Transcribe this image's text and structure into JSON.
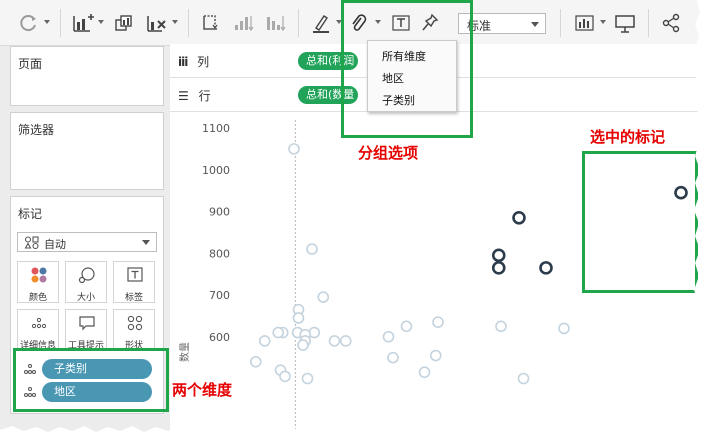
{
  "toolbar": {
    "icons": [
      "refresh-icon",
      "new-chart-icon",
      "duplicate-icon",
      "clear-icon",
      "swap-icon",
      "sort-asc-icon",
      "sort-desc-icon",
      "highlight-icon",
      "paperclip-icon",
      "text-label-icon",
      "pin-icon",
      "show-me-icon",
      "presentation-icon",
      "share-icon"
    ],
    "fit_select_value": "标准"
  },
  "panes": {
    "pages_title": "页面",
    "filters_title": "筛选器",
    "marks_title": "标记",
    "marks_type": "自动",
    "mark_buttons": [
      {
        "label": "颜色",
        "icon": "color-icon"
      },
      {
        "label": "大小",
        "icon": "size-icon"
      },
      {
        "label": "标签",
        "icon": "label-icon"
      },
      {
        "label": "详细信息",
        "icon": "detail-icon"
      },
      {
        "label": "工具提示",
        "icon": "tooltip-icon"
      },
      {
        "label": "形状",
        "icon": "shape-icon"
      }
    ],
    "detail_pills": [
      "子类别",
      "地区"
    ]
  },
  "shelves": {
    "columns_label": "列",
    "columns_pill": "总和(利润",
    "rows_label": "行",
    "rows_pill": "总和(数量"
  },
  "menu": {
    "items": [
      "所有维度",
      "地区",
      "子类别"
    ]
  },
  "annotations": {
    "group_options": "分组选项",
    "selected_marks": "选中的标记",
    "two_dimensions": "两个维度"
  },
  "chart_data": {
    "type": "scatter",
    "ylabel": "数量",
    "y_ticks": [
      "1100",
      "1000",
      "900",
      "800",
      "700",
      "600"
    ],
    "ylim": [
      500,
      1100
    ],
    "points": [
      {
        "x": 0.12,
        "y": 1050
      },
      {
        "x": 0.16,
        "y": 810
      },
      {
        "x": 0.13,
        "y": 665
      },
      {
        "x": 0.185,
        "y": 695
      },
      {
        "x": 0.13,
        "y": 645
      },
      {
        "x": 0.128,
        "y": 610
      },
      {
        "x": 0.165,
        "y": 610
      },
      {
        "x": 0.145,
        "y": 605
      },
      {
        "x": 0.145,
        "y": 590
      },
      {
        "x": 0.095,
        "y": 610
      },
      {
        "x": 0.085,
        "y": 610
      },
      {
        "x": 0.055,
        "y": 590
      },
      {
        "x": 0.14,
        "y": 580
      },
      {
        "x": 0.21,
        "y": 590
      },
      {
        "x": 0.235,
        "y": 590
      },
      {
        "x": 0.33,
        "y": 600
      },
      {
        "x": 0.37,
        "y": 625
      },
      {
        "x": 0.44,
        "y": 635
      },
      {
        "x": 0.58,
        "y": 625
      },
      {
        "x": 0.72,
        "y": 620
      },
      {
        "x": 0.035,
        "y": 540
      },
      {
        "x": 0.09,
        "y": 520
      },
      {
        "x": 0.34,
        "y": 550
      },
      {
        "x": 0.435,
        "y": 555
      },
      {
        "x": 0.41,
        "y": 515
      },
      {
        "x": 0.63,
        "y": 500
      },
      {
        "x": 0.1,
        "y": 505
      },
      {
        "x": 0.15,
        "y": 500
      }
    ],
    "selected_points": [
      {
        "x": 0.62,
        "y": 885
      },
      {
        "x": 0.98,
        "y": 945
      },
      {
        "x": 0.575,
        "y": 795
      },
      {
        "x": 0.575,
        "y": 765
      },
      {
        "x": 0.68,
        "y": 765
      }
    ],
    "reference_line": "dashed vertical line near x = 0.123"
  }
}
